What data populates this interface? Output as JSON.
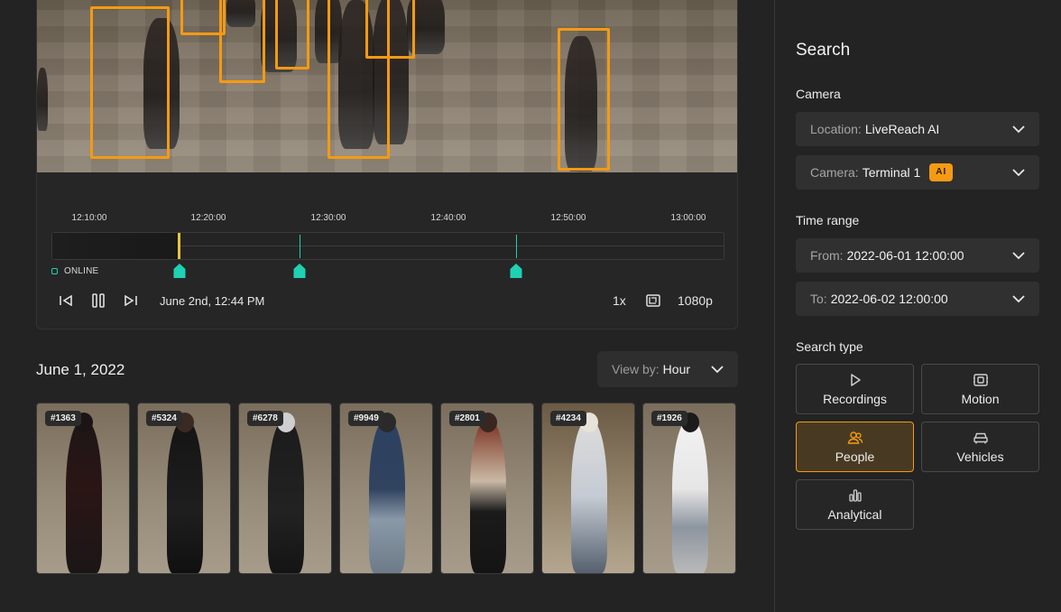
{
  "player": {
    "timeline_ticks": [
      "12:10:00",
      "12:20:00",
      "12:30:00",
      "12:40:00",
      "12:50:00",
      "13:00:00"
    ],
    "status": "ONLINE",
    "current_time": "June 2nd, 12:44 PM",
    "speed": "1x",
    "quality": "1080p",
    "colors": {
      "bbox": "#f59a12",
      "event": "#1fd1b3",
      "playhead": "#e7c33c"
    }
  },
  "results": {
    "date": "June 1, 2022",
    "view_by": {
      "label": "View by:",
      "value": "Hour"
    },
    "thumbnails": [
      "#1363",
      "#5324",
      "#6278",
      "#9949",
      "#2801",
      "#4234",
      "#1926"
    ]
  },
  "sidebar": {
    "title": "Search",
    "camera_label": "Camera",
    "location": {
      "label": "Location:",
      "value": "LiveReach AI"
    },
    "camera": {
      "label": "Camera:",
      "value": "Terminal 1",
      "badge": "AI"
    },
    "time_range_label": "Time range",
    "from": {
      "label": "From:",
      "value": "2022-06-01 12:00:00"
    },
    "to": {
      "label": "To:",
      "value": "2022-06-02 12:00:00"
    },
    "search_type_label": "Search type",
    "types": [
      "Recordings",
      "Motion",
      "People",
      "Vehicles",
      "Analytical"
    ],
    "active_type": "People",
    "accent": "#f59a12"
  }
}
